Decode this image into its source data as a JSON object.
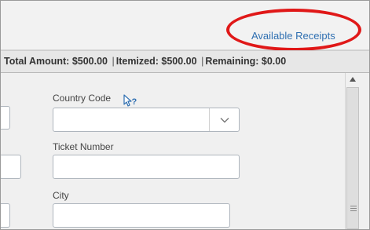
{
  "header": {
    "available_receipts_link": "Available Receipts"
  },
  "totals": {
    "total_label": "Total Amount:",
    "total_value": "$500.00",
    "itemized_label": "Itemized:",
    "itemized_value": "$500.00",
    "remaining_label": "Remaining:",
    "remaining_value": "$0.00",
    "separator": "|"
  },
  "form": {
    "country_code": {
      "label": "Country Code",
      "value": ""
    },
    "ticket_number": {
      "label": "Ticket Number",
      "value": ""
    },
    "city": {
      "label": "City",
      "value": ""
    }
  },
  "colors": {
    "link": "#2f6fb1",
    "highlight": "#e01818"
  }
}
